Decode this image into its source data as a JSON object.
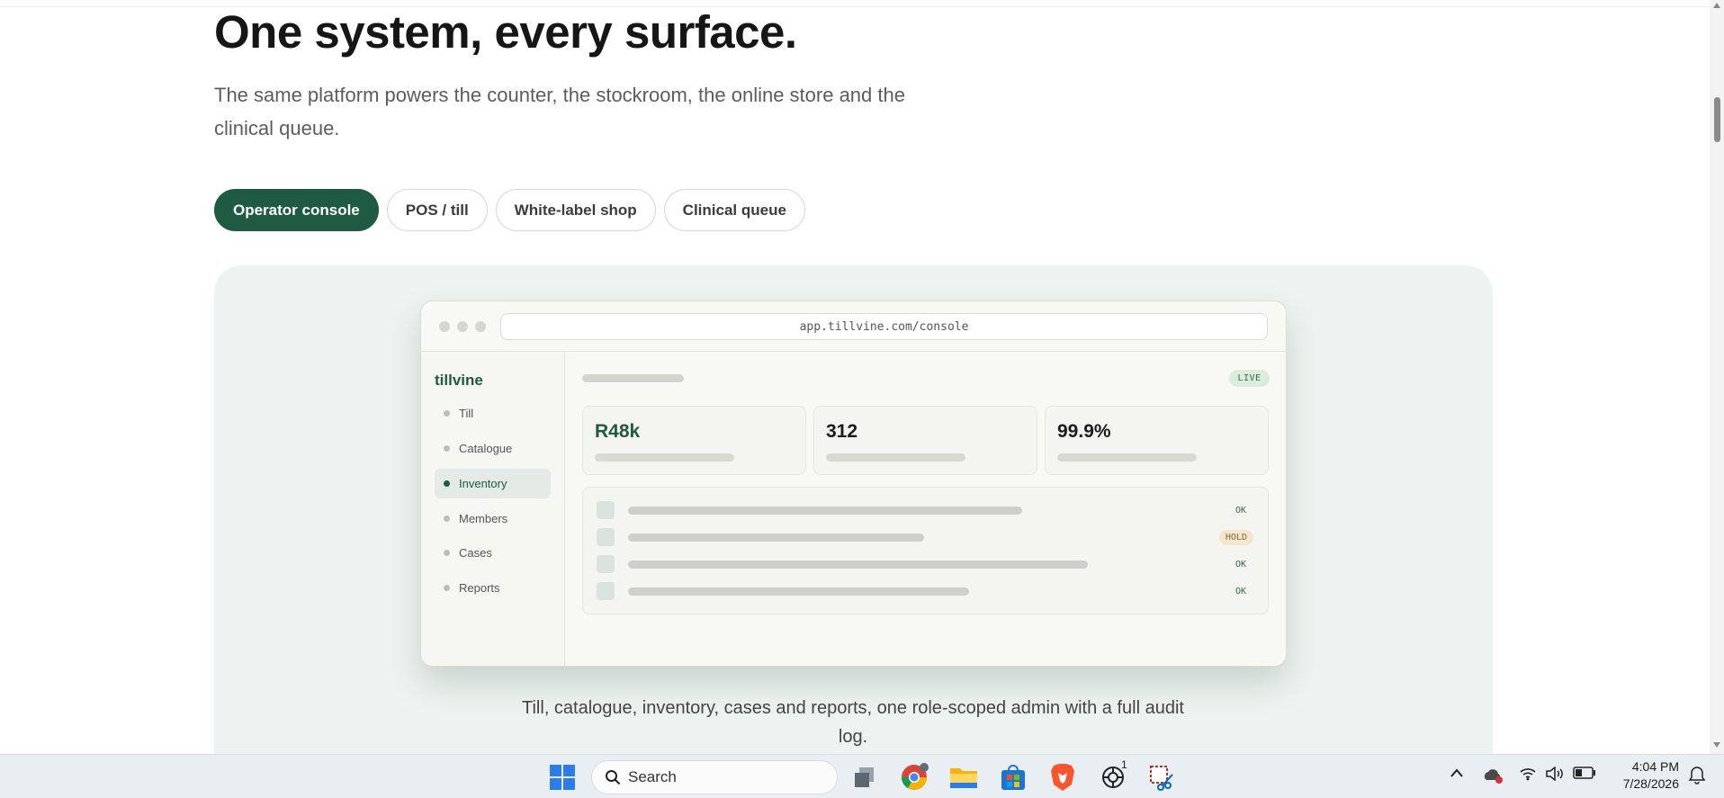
{
  "hero": {
    "title": "One system, every surface.",
    "subtitle": "The same platform powers the counter, the stockroom, the online store and the clinical queue."
  },
  "tabs": [
    {
      "label": "Operator console",
      "active": true
    },
    {
      "label": "POS / till",
      "active": false
    },
    {
      "label": "White-label shop",
      "active": false
    },
    {
      "label": "Clinical queue",
      "active": false
    }
  ],
  "preview": {
    "url": "app.tillvine.com/console",
    "brand": "tillvine",
    "nav": [
      {
        "label": "Till",
        "active": false
      },
      {
        "label": "Catalogue",
        "active": false
      },
      {
        "label": "Inventory",
        "active": true
      },
      {
        "label": "Members",
        "active": false
      },
      {
        "label": "Cases",
        "active": false
      },
      {
        "label": "Reports",
        "active": false
      }
    ],
    "live_badge": "LIVE",
    "stats": [
      {
        "value": "R48k"
      },
      {
        "value": "312"
      },
      {
        "value": "99.9%"
      }
    ],
    "rows": [
      {
        "status": "OK"
      },
      {
        "status": "HOLD"
      },
      {
        "status": "OK"
      },
      {
        "status": "OK"
      }
    ]
  },
  "caption": "Till, catalogue, inventory, cases and reports, one role-scoped admin with a full audit log.",
  "taskbar": {
    "search_label": "Search",
    "notification_count": "1",
    "time": "4:04 PM",
    "date": "7/28/2026"
  },
  "colors": {
    "accent": "#1f5a43",
    "stage_bg": "#edf3f0",
    "hold_badge": "#f3e6cf"
  }
}
